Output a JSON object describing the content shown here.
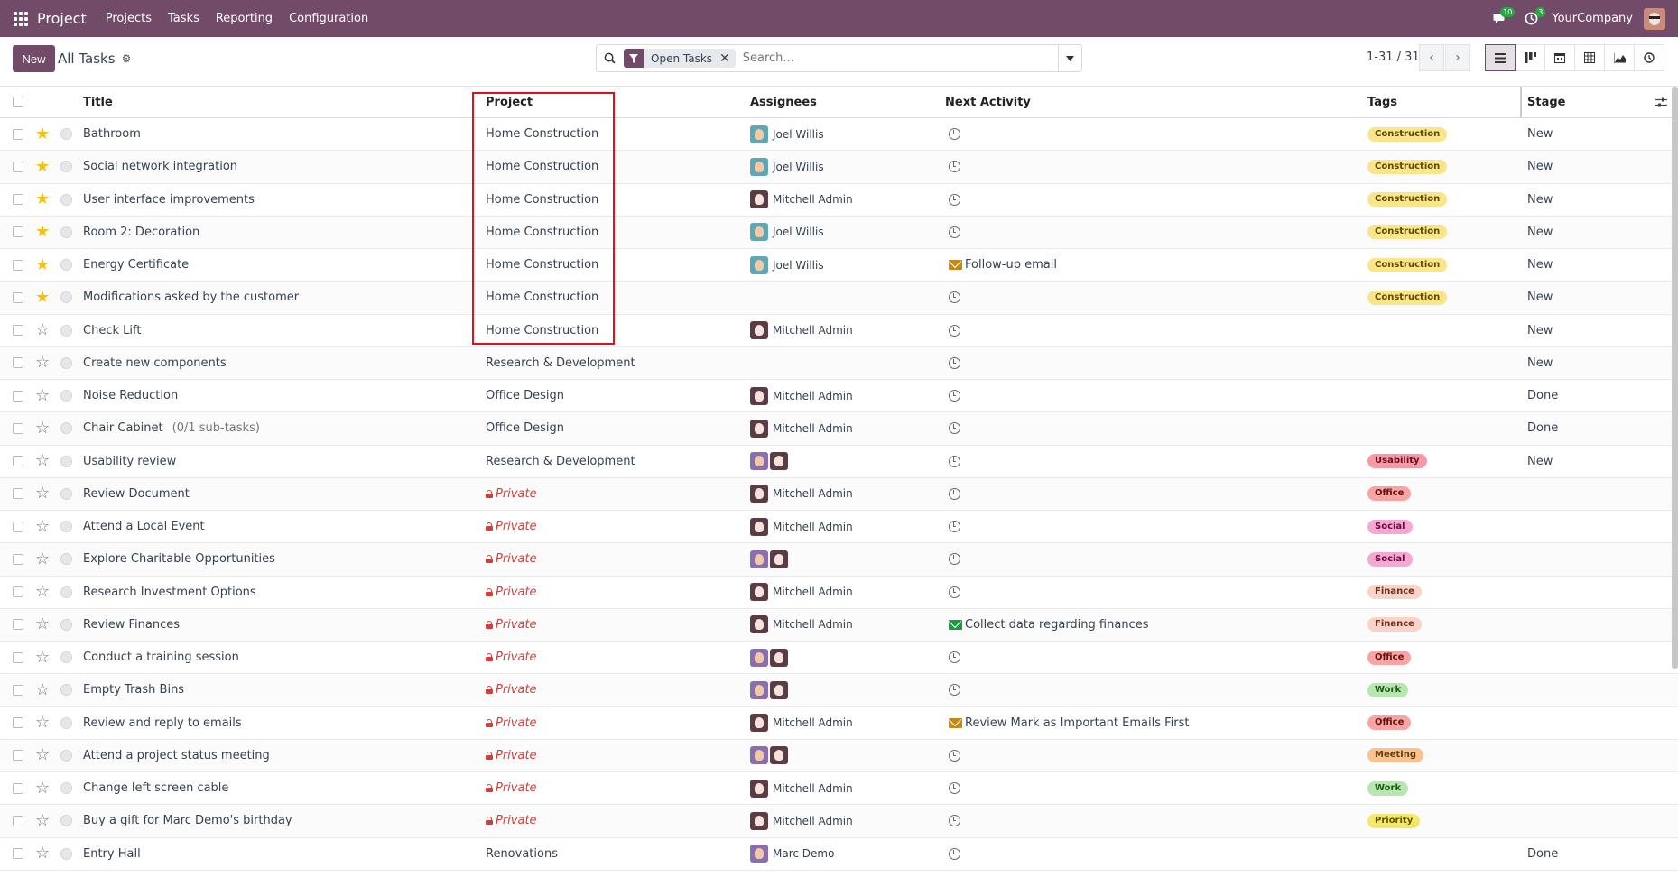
{
  "navbar": {
    "app_name": "Project",
    "menus": [
      "Projects",
      "Tasks",
      "Reporting",
      "Configuration"
    ],
    "messages_count": "10",
    "activities_count": "3",
    "company": "YourCompany"
  },
  "control_panel": {
    "new_label": "New",
    "title": "All Tasks",
    "filter_label": "Open Tasks",
    "search_placeholder": "Search...",
    "pager": "1-31 / 31"
  },
  "columns": {
    "title": "Title",
    "project": "Project",
    "assignees": "Assignees",
    "next_activity": "Next Activity",
    "tags": "Tags",
    "stage": "Stage"
  },
  "colors": {
    "brand": "#714B67",
    "highlight": "#e0111a",
    "star": "#f3c10e",
    "private": "#d23f3a"
  },
  "rows": [
    {
      "title": "Bathroom",
      "subtasks": "",
      "starred": true,
      "project": "Home Construction",
      "private": false,
      "assignees": [
        "joel"
      ],
      "assignee_name": "Joel Willis",
      "activity": "",
      "activity_type": "clock",
      "tag": "Construction",
      "stage": "New"
    },
    {
      "title": "Social network integration",
      "subtasks": "",
      "starred": true,
      "project": "Home Construction",
      "private": false,
      "assignees": [
        "joel"
      ],
      "assignee_name": "Joel Willis",
      "activity": "",
      "activity_type": "clock",
      "tag": "Construction",
      "stage": "New"
    },
    {
      "title": "User interface improvements",
      "subtasks": "",
      "starred": true,
      "project": "Home Construction",
      "private": false,
      "assignees": [
        "mitchell"
      ],
      "assignee_name": "Mitchell Admin",
      "activity": "",
      "activity_type": "clock",
      "tag": "Construction",
      "stage": "New"
    },
    {
      "title": "Room 2: Decoration",
      "subtasks": "",
      "starred": true,
      "project": "Home Construction",
      "private": false,
      "assignees": [
        "joel"
      ],
      "assignee_name": "Joel Willis",
      "activity": "",
      "activity_type": "clock",
      "tag": "Construction",
      "stage": "New"
    },
    {
      "title": "Energy Certificate",
      "subtasks": "",
      "starred": true,
      "project": "Home Construction",
      "private": false,
      "assignees": [
        "joel"
      ],
      "assignee_name": "Joel Willis",
      "activity": "Follow-up email",
      "activity_type": "mail-orange",
      "tag": "Construction",
      "stage": "New"
    },
    {
      "title": "Modifications asked by the customer",
      "subtasks": "",
      "starred": true,
      "project": "Home Construction",
      "private": false,
      "assignees": [],
      "assignee_name": "",
      "activity": "",
      "activity_type": "clock",
      "tag": "Construction",
      "stage": "New"
    },
    {
      "title": "Check Lift",
      "subtasks": "",
      "starred": false,
      "project": "Home Construction",
      "private": false,
      "assignees": [
        "mitchell"
      ],
      "assignee_name": "Mitchell Admin",
      "activity": "",
      "activity_type": "clock",
      "tag": "",
      "stage": "New"
    },
    {
      "title": "Create new components",
      "subtasks": "",
      "starred": false,
      "project": "Research & Development",
      "private": false,
      "assignees": [],
      "assignee_name": "",
      "activity": "",
      "activity_type": "clock",
      "tag": "",
      "stage": "New"
    },
    {
      "title": "Noise Reduction",
      "subtasks": "",
      "starred": false,
      "project": "Office Design",
      "private": false,
      "assignees": [
        "mitchell"
      ],
      "assignee_name": "Mitchell Admin",
      "activity": "",
      "activity_type": "clock",
      "tag": "",
      "stage": "Done"
    },
    {
      "title": "Chair Cabinet",
      "subtasks": "(0/1 sub-tasks)",
      "starred": false,
      "project": "Office Design",
      "private": false,
      "assignees": [
        "mitchell"
      ],
      "assignee_name": "Mitchell Admin",
      "activity": "",
      "activity_type": "clock",
      "tag": "",
      "stage": "Done"
    },
    {
      "title": "Usability review",
      "subtasks": "",
      "starred": false,
      "project": "Research & Development",
      "private": false,
      "assignees": [
        "marc",
        "mitchell"
      ],
      "assignee_name": "",
      "activity": "",
      "activity_type": "clock",
      "tag": "Usability",
      "stage": "New"
    },
    {
      "title": "Review Document",
      "subtasks": "",
      "starred": false,
      "project": "Private",
      "private": true,
      "assignees": [
        "mitchell"
      ],
      "assignee_name": "Mitchell Admin",
      "activity": "",
      "activity_type": "clock",
      "tag": "Office",
      "stage": ""
    },
    {
      "title": "Attend a Local Event",
      "subtasks": "",
      "starred": false,
      "project": "Private",
      "private": true,
      "assignees": [
        "mitchell"
      ],
      "assignee_name": "Mitchell Admin",
      "activity": "",
      "activity_type": "clock",
      "tag": "Social",
      "stage": ""
    },
    {
      "title": "Explore Charitable Opportunities",
      "subtasks": "",
      "starred": false,
      "project": "Private",
      "private": true,
      "assignees": [
        "marc",
        "mitchell"
      ],
      "assignee_name": "",
      "activity": "",
      "activity_type": "clock",
      "tag": "Social",
      "stage": ""
    },
    {
      "title": "Research Investment Options",
      "subtasks": "",
      "starred": false,
      "project": "Private",
      "private": true,
      "assignees": [
        "mitchell"
      ],
      "assignee_name": "Mitchell Admin",
      "activity": "",
      "activity_type": "clock",
      "tag": "Finance",
      "stage": ""
    },
    {
      "title": "Review Finances",
      "subtasks": "",
      "starred": false,
      "project": "Private",
      "private": true,
      "assignees": [
        "mitchell"
      ],
      "assignee_name": "Mitchell Admin",
      "activity": "Collect data regarding finances",
      "activity_type": "mail-green",
      "tag": "Finance",
      "stage": ""
    },
    {
      "title": "Conduct a training session",
      "subtasks": "",
      "starred": false,
      "project": "Private",
      "private": true,
      "assignees": [
        "marc",
        "mitchell"
      ],
      "assignee_name": "",
      "activity": "",
      "activity_type": "clock",
      "tag": "Office",
      "stage": ""
    },
    {
      "title": "Empty Trash Bins",
      "subtasks": "",
      "starred": false,
      "project": "Private",
      "private": true,
      "assignees": [
        "marc",
        "mitchell"
      ],
      "assignee_name": "",
      "activity": "",
      "activity_type": "clock",
      "tag": "Work",
      "stage": ""
    },
    {
      "title": "Review and reply to emails",
      "subtasks": "",
      "starred": false,
      "project": "Private",
      "private": true,
      "assignees": [
        "mitchell"
      ],
      "assignee_name": "Mitchell Admin",
      "activity": "Review Mark as Important Emails First",
      "activity_type": "mail-orange",
      "tag": "Office",
      "stage": ""
    },
    {
      "title": "Attend a project status meeting",
      "subtasks": "",
      "starred": false,
      "project": "Private",
      "private": true,
      "assignees": [
        "marc",
        "mitchell"
      ],
      "assignee_name": "",
      "activity": "",
      "activity_type": "clock",
      "tag": "Meeting",
      "stage": ""
    },
    {
      "title": "Change left screen cable",
      "subtasks": "",
      "starred": false,
      "project": "Private",
      "private": true,
      "assignees": [
        "mitchell"
      ],
      "assignee_name": "Mitchell Admin",
      "activity": "",
      "activity_type": "clock",
      "tag": "Work",
      "stage": ""
    },
    {
      "title": "Buy a gift for Marc Demo's birthday",
      "subtasks": "",
      "starred": false,
      "project": "Private",
      "private": true,
      "assignees": [
        "mitchell"
      ],
      "assignee_name": "Mitchell Admin",
      "activity": "",
      "activity_type": "clock",
      "tag": "Priority",
      "stage": ""
    },
    {
      "title": "Entry Hall",
      "subtasks": "",
      "starred": false,
      "project": "Renovations",
      "private": false,
      "assignees": [
        "marc"
      ],
      "assignee_name": "Marc Demo",
      "activity": "",
      "activity_type": "clock",
      "tag": "",
      "stage": "Done"
    }
  ],
  "tag_colors": {
    "Construction": {
      "bg": "#fbe58a",
      "fg": "#5c4a00"
    },
    "Usability": {
      "bg": "#f59aa6",
      "fg": "#6b0d1c"
    },
    "Office": {
      "bg": "#f7a4a4",
      "fg": "#6d0f0f"
    },
    "Social": {
      "bg": "#f6a8d2",
      "fg": "#6b0b42"
    },
    "Finance": {
      "bg": "#f9d3c7",
      "fg": "#6d2e1a"
    },
    "Work": {
      "bg": "#b8e6b0",
      "fg": "#1c5a13"
    },
    "Meeting": {
      "bg": "#f8c390",
      "fg": "#6b3a0a"
    },
    "Priority": {
      "bg": "#f5e76a",
      "fg": "#5a5200"
    }
  }
}
